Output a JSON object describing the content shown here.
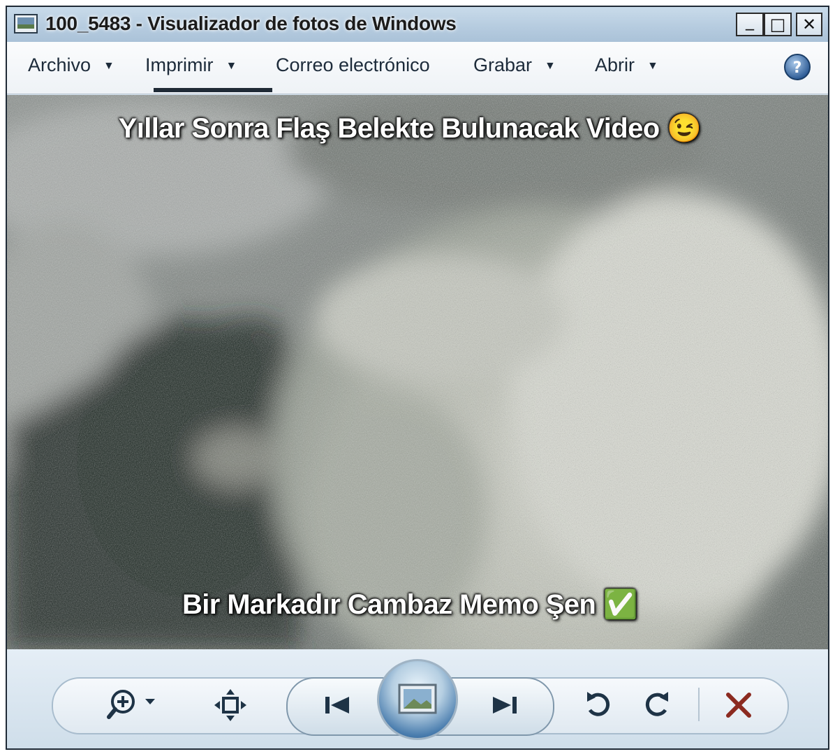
{
  "window": {
    "title": "100_5483 - Visualizador de fotos de Windows",
    "controls": {
      "minimize": "_",
      "maximize": "□",
      "close": "✕"
    }
  },
  "menu": {
    "items": [
      {
        "label": "Archivo",
        "has_dropdown": true
      },
      {
        "label": "Imprimir",
        "has_dropdown": true
      },
      {
        "label": "Correo electrónico",
        "has_dropdown": false
      },
      {
        "label": "Grabar",
        "has_dropdown": true
      },
      {
        "label": "Abrir",
        "has_dropdown": true
      }
    ],
    "help_icon": "help-icon"
  },
  "photo": {
    "caption_top": "Yıllar Sonra Flaş Belekte Bulunacak Video 😉",
    "caption_bottom": "Bir Markadır Cambaz Memo Şen ✅"
  },
  "toolbar": {
    "buttons": [
      {
        "name": "zoom",
        "icon": "zoom-icon"
      },
      {
        "name": "actual-size",
        "icon": "fit-to-window-icon"
      },
      {
        "name": "previous",
        "icon": "previous-icon"
      },
      {
        "name": "slideshow",
        "icon": "slideshow-icon"
      },
      {
        "name": "next",
        "icon": "next-icon"
      },
      {
        "name": "rotate-left",
        "icon": "rotate-counterclockwise-icon"
      },
      {
        "name": "rotate-right",
        "icon": "rotate-clockwise-icon"
      },
      {
        "name": "delete",
        "icon": "delete-icon"
      }
    ]
  },
  "colors": {
    "delete_icon": "#8b2a20",
    "icon_dark": "#1e3346",
    "slideshow_blue": "#1c4f86"
  }
}
